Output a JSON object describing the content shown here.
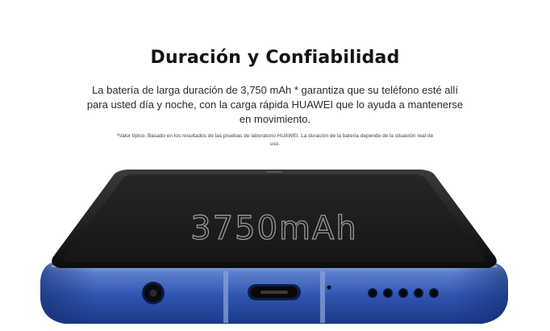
{
  "section": {
    "title": "Duración y Confiabilidad",
    "description": "La batería de larga duración de 3,750 mAh * garantiza que su teléfono esté allí para usted día y noche, con la carga rápida HUAWEI que lo ayuda a mantenerse en movimiento.",
    "footnote": "*Valor típico. Basado en los resultados de las pruebas de laboratorio HUAWEI. La duración de la batería depende de la situación real de uso."
  },
  "phone": {
    "screen_text": "3750mAh",
    "body_color": "#3d62b8",
    "screen_color": "#1e1e1e"
  }
}
